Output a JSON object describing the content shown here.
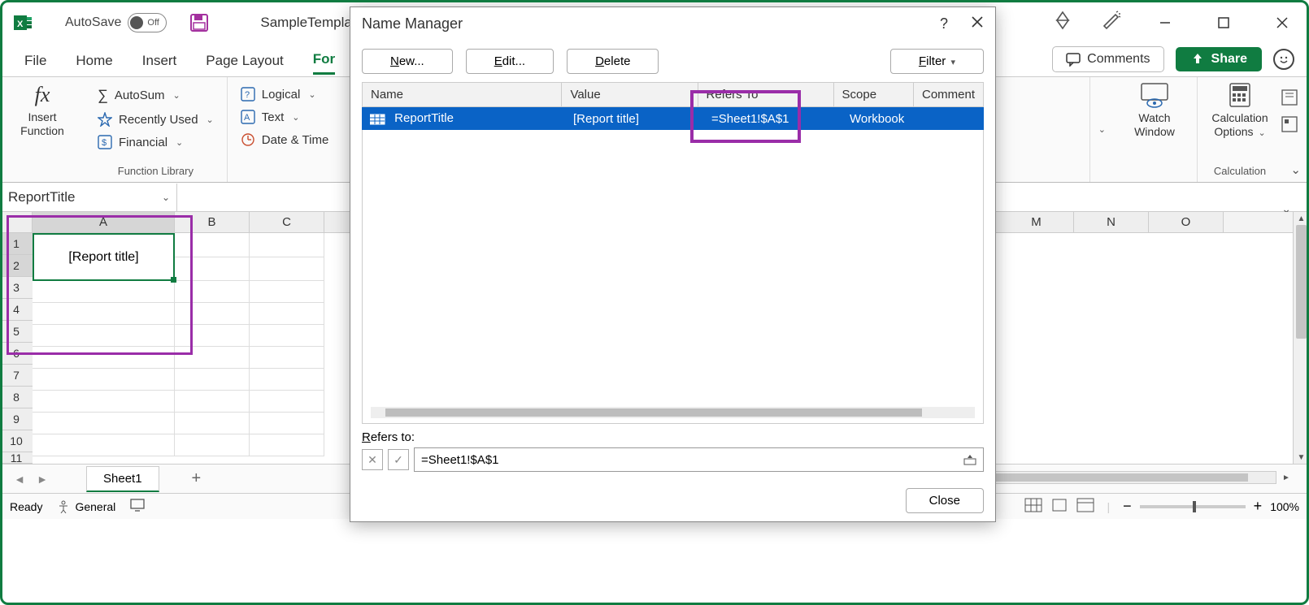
{
  "titlebar": {
    "autosave_label": "AutoSave",
    "autosave_state": "Off",
    "filename": "SampleTemplat"
  },
  "window_controls": {
    "minimize": "—",
    "maximize": "▢",
    "close": "✕"
  },
  "tabs": {
    "file": "File",
    "home": "Home",
    "insert": "Insert",
    "page_layout": "Page Layout",
    "formulas_partial": "For",
    "comments": "Comments",
    "share": "Share"
  },
  "ribbon": {
    "insert_function": "Insert\nFunction",
    "autosum": "AutoSum",
    "recently_used": "Recently Used",
    "financial": "Financial",
    "logical": "Logical",
    "text": "Text",
    "date_time": "Date & Time",
    "group_function_library": "Function Library",
    "watch_window": "Watch\nWindow",
    "calc_options": "Calculation\nOptions",
    "group_calculation": "Calculation"
  },
  "namebox": "ReportTitle",
  "grid": {
    "columns": [
      "A",
      "B",
      "C",
      "M",
      "N",
      "O"
    ],
    "rows": [
      "1",
      "2",
      "3",
      "4",
      "5",
      "6",
      "7",
      "8",
      "9",
      "10",
      "11"
    ],
    "a1a2_value": "[Report title]"
  },
  "sheet": {
    "name": "Sheet1"
  },
  "status": {
    "ready": "Ready",
    "general": "General",
    "zoom": "100%"
  },
  "dialog": {
    "title": "Name Manager",
    "help": "?",
    "close_x": "✕",
    "new": "New...",
    "edit": "Edit...",
    "delete": "Delete",
    "filter": "Filter",
    "columns": {
      "name": "Name",
      "value": "Value",
      "refers": "Refers To",
      "scope": "Scope",
      "comment": "Comment"
    },
    "row": {
      "name": "ReportTitle",
      "value": "[Report title]",
      "refers": "=Sheet1!$A$1",
      "scope": "Workbook",
      "comment": ""
    },
    "refers_label": "Refers to:",
    "refers_value": "=Sheet1!$A$1",
    "close_btn": "Close"
  }
}
